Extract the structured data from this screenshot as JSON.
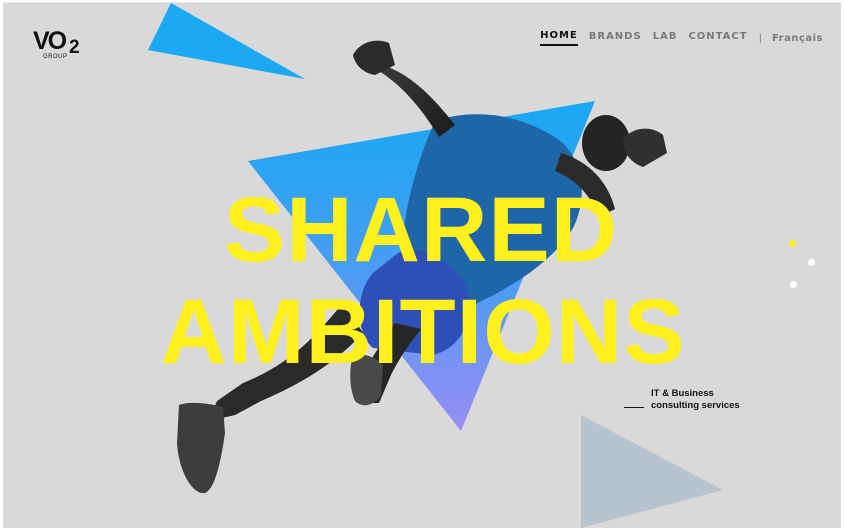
{
  "brand": {
    "logo_main": "VO",
    "logo_sup": "2",
    "logo_sub": "GROUP"
  },
  "nav": {
    "items": [
      {
        "label": "HOME",
        "active": true
      },
      {
        "label": "BRANDS",
        "active": false
      },
      {
        "label": "LAB",
        "active": false
      },
      {
        "label": "CONTACT",
        "active": false
      }
    ],
    "separator": "|",
    "language": "Français"
  },
  "hero": {
    "line1": "SHARED",
    "line2": "AMBITIONS"
  },
  "tagline": {
    "line1": "IT & Business",
    "line2": "consulting services"
  },
  "colors": {
    "background": "#d9d9d9",
    "headline_yellow": "#fff01e",
    "triangle_blue": "#1aa9f2",
    "triangle_violet": "#9a8cf5",
    "triangle_steel": "#b7c4cf",
    "text_dark": "#111111"
  }
}
